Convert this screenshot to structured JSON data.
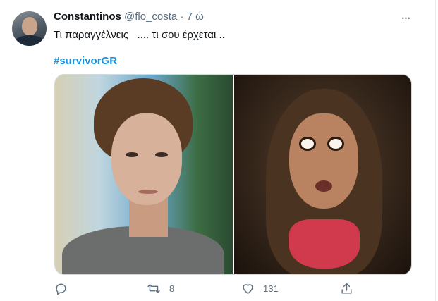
{
  "tweet": {
    "author_name": "Constantinos",
    "author_handle": "@flo_costa",
    "separator": "·",
    "time": "7 ώ",
    "more_label": "•••",
    "text": "Τι παραγγέλνεις   .... τι σου έρχεται ..",
    "hashtag": "#survivorGR"
  },
  "actions": {
    "reply_count": "",
    "retweet_count": "8",
    "like_count": "131"
  },
  "icons": {
    "reply": "reply-icon",
    "retweet": "retweet-icon",
    "like": "heart-icon",
    "share": "share-icon",
    "more": "more-icon"
  },
  "colors": {
    "hashtag": "#1b95e0",
    "secondary_text": "#5b7083"
  }
}
